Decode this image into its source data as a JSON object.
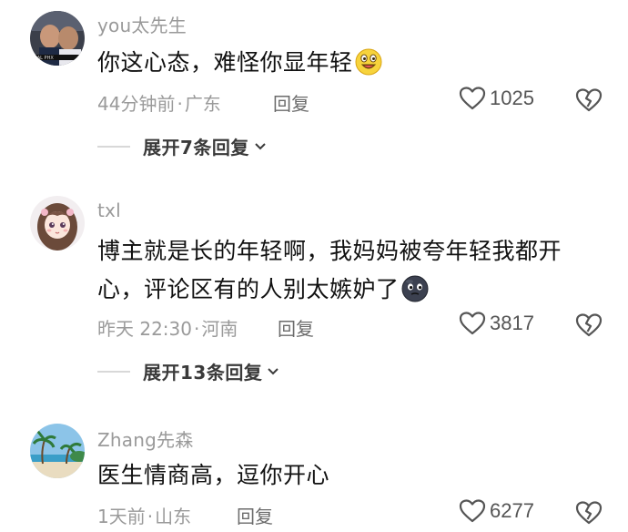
{
  "comments": [
    {
      "username": "you太先生",
      "text": "你这心态，难怪你显年轻",
      "emoji": "smiley-emoji",
      "time": "44分钟前",
      "location": "广东",
      "reply_label": "回复",
      "likes": "1025",
      "expand_label": "展开7条回复"
    },
    {
      "username": "txl",
      "text_line1": "博主就是长的年轻啊，我妈妈被夸年轻我都开",
      "text_line2": "心，评论区有的人别太嫉妒了",
      "emoji": "dark-face-emoji",
      "time": "昨天 22:30",
      "location": "河南",
      "reply_label": "回复",
      "likes": "3817",
      "expand_label": "展开13条回复"
    },
    {
      "username": "Zhang先森",
      "text": "医生情商高，逗你开心",
      "time": "1天前",
      "location": "山东",
      "reply_label": "回复",
      "likes": "6277"
    }
  ],
  "separator": "·",
  "icons": {
    "like": "heart-outline-icon",
    "dislike": "broken-heart-icon",
    "expand": "chevron-down-icon"
  },
  "colors": {
    "text": "#111111",
    "meta": "#9a9a9a",
    "expand": "#3a3a3a",
    "emoji_yellow": "#f7d33c"
  }
}
